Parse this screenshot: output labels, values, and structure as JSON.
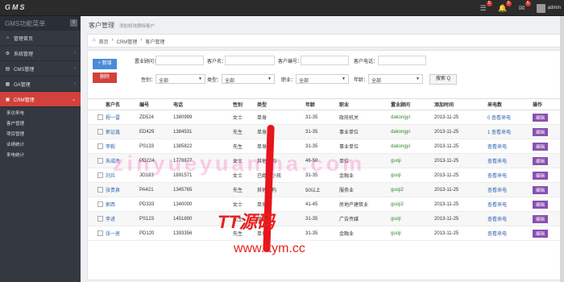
{
  "topbar": {
    "logo": "GMS",
    "badges": [
      "5",
      "5",
      "5"
    ],
    "user": "admin"
  },
  "sidebar": {
    "title": "GMS功能菜单",
    "items": [
      {
        "label": "管理首页"
      },
      {
        "label": "系统管理"
      },
      {
        "label": "CMS管理"
      },
      {
        "label": "OA管理"
      },
      {
        "label": "CRM管理"
      }
    ],
    "subitems": [
      "来访来电",
      "客户管理",
      "项目管理",
      "业绩统计",
      "来电统计"
    ]
  },
  "page": {
    "title": "客户管理",
    "subtitle": "添加修改删除客户",
    "breadcrumb": [
      "首页",
      "CRM管理",
      "客户管理"
    ]
  },
  "toolbar": {
    "add_label": "+ 新增",
    "delete_label": "删除"
  },
  "filters": {
    "purchase_time": "置业顾问：",
    "customer_name": "客户名：",
    "customer_no": "客户编号：",
    "customer_phone": "客户电话：",
    "gender": "性别：",
    "gender_value": "全部",
    "type": "类型：",
    "type_value": "全部",
    "job": "职业：",
    "job_value": "全部",
    "age": "年龄：",
    "age_value": "全部",
    "search_label": "搜索 Q"
  },
  "table": {
    "headers": [
      "客户名",
      "编号",
      "电话",
      "性别",
      "类型",
      "年龄",
      "职业",
      "置业顾问",
      "添加时间",
      "来电数",
      "操作"
    ],
    "rows": [
      {
        "name": "程一雷",
        "code": "ZD524",
        "phone": "1380999",
        "gender": "女士",
        "type": "单身",
        "age": "31-35",
        "job": "政府机关",
        "advisor": "dakongyi",
        "date": "2013-11-25",
        "calls": "0 查看来电",
        "op": "编辑"
      },
      {
        "name": "郭证鑫",
        "code": "ED429",
        "phone": "1384531",
        "gender": "先生",
        "type": "单身",
        "age": "31-35",
        "job": "事业单位",
        "advisor": "dakongyi",
        "date": "2013-11-25",
        "calls": "1 查看来电",
        "op": "编辑"
      },
      {
        "name": "李毅",
        "code": "PS133",
        "phone": "1385822",
        "gender": "先生",
        "type": "单身",
        "age": "31-35",
        "job": "事业单位",
        "advisor": "dakongyi",
        "date": "2013-11-25",
        "calls": "查看来电",
        "op": "编辑"
      },
      {
        "name": "朱成杰",
        "code": "PD224",
        "phone": "1778877",
        "gender": "女士",
        "type": "其他结构",
        "age": "46-50",
        "job": "单位",
        "advisor": "guoji",
        "date": "2013-11-25",
        "calls": "查看来电",
        "op": "编辑"
      },
      {
        "name": "刘兵",
        "code": "JO183",
        "phone": "1891571",
        "gender": "女士",
        "type": "已婚有小孩",
        "age": "31-35",
        "job": "金融业",
        "advisor": "guoji",
        "date": "2013-11-25",
        "calls": "查看来电",
        "op": "编辑"
      },
      {
        "name": "张贵泉",
        "code": "PA421",
        "phone": "1345765",
        "gender": "先生",
        "type": "其他结构",
        "age": "50以上",
        "job": "服务业",
        "advisor": "guoji2",
        "date": "2013-11-25",
        "calls": "查看来电",
        "op": "编辑"
      },
      {
        "name": "郭西",
        "code": "PD333",
        "phone": "1340000",
        "gender": "女士",
        "type": "单身",
        "age": "41-45",
        "job": "房地产建筑业",
        "advisor": "guoji2",
        "date": "2013-11-25",
        "calls": "查看来电",
        "op": "编辑"
      },
      {
        "name": "李进",
        "code": "PS123",
        "phone": "1451890",
        "gender": "先生",
        "type": "单身",
        "age": "31-35",
        "job": "广告传媒",
        "advisor": "guoji",
        "date": "2013-11-25",
        "calls": "查看来电",
        "op": "编辑"
      },
      {
        "name": "张一居",
        "code": "PD120",
        "phone": "1393356",
        "gender": "先生",
        "type": "单身",
        "age": "31-35",
        "job": "金融业",
        "advisor": "guoji",
        "date": "2013-11-25",
        "calls": "查看来电",
        "op": "编辑"
      }
    ]
  },
  "watermarks": {
    "pinyin": "zinyueyuanma.com",
    "brand": "TT源码",
    "url": "www.ttym.cc"
  }
}
